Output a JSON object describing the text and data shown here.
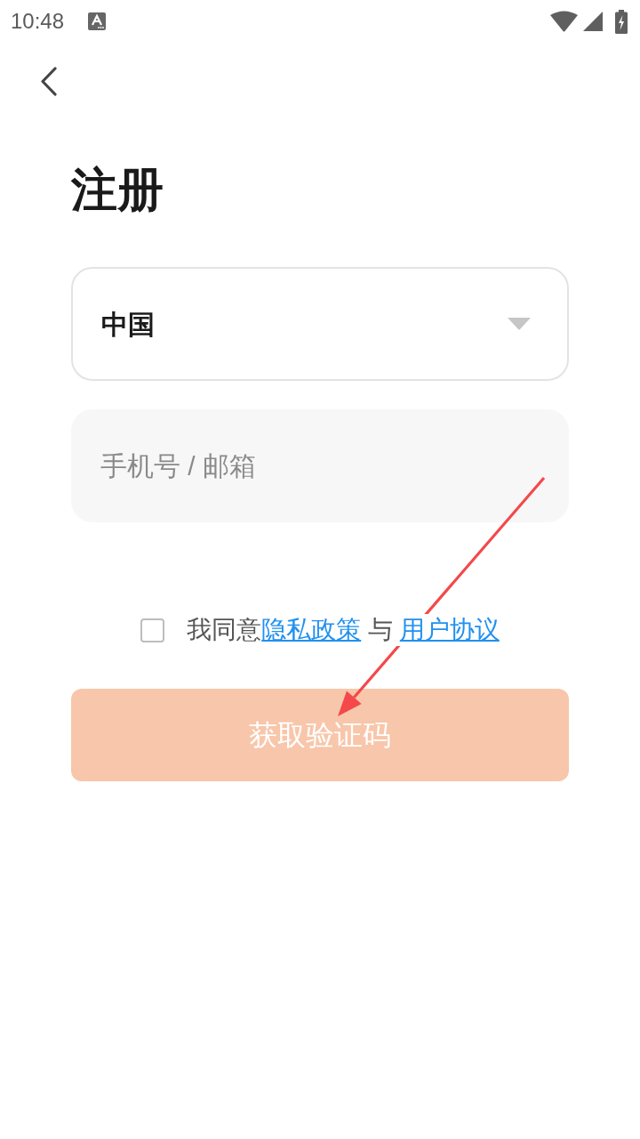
{
  "status_bar": {
    "time": "10:48"
  },
  "title": "注册",
  "region_select": {
    "value": "中国"
  },
  "account_field": {
    "placeholder": "手机号 / 邮箱"
  },
  "agreement": {
    "checked": false,
    "parts": [
      {
        "kind": "text",
        "text": "我同意"
      },
      {
        "kind": "link",
        "text": "隐私政策"
      },
      {
        "kind": "text",
        "text": " 与 "
      },
      {
        "kind": "link",
        "text": "用户协议"
      }
    ]
  },
  "submit_button": {
    "label": "获取验证码",
    "disabled": true
  }
}
